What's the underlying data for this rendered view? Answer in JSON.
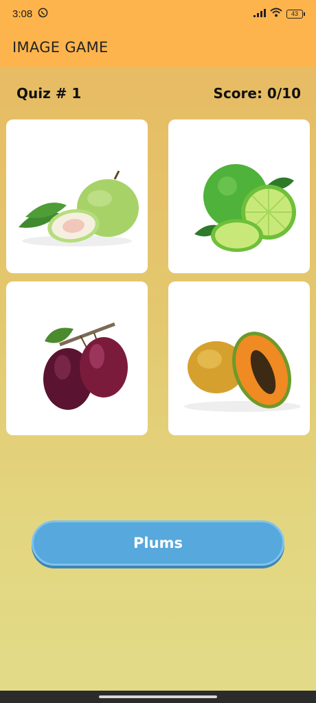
{
  "status_bar": {
    "time": "3:08",
    "battery": "43",
    "icons": [
      "whatsapp-icon",
      "signal-icon",
      "wifi-icon",
      "battery-icon"
    ]
  },
  "app_bar": {
    "title": "IMAGE GAME"
  },
  "quiz": {
    "label": "Quiz # 1",
    "score": "Score: 0/10"
  },
  "options": [
    {
      "name": "guava-image"
    },
    {
      "name": "lime-image"
    },
    {
      "name": "plum-image"
    },
    {
      "name": "papaya-image"
    }
  ],
  "answer_button": {
    "label": "Plums",
    "color": "#57a8dc"
  },
  "colors": {
    "app_bar": "#feb44c",
    "card": "#ffffff"
  }
}
